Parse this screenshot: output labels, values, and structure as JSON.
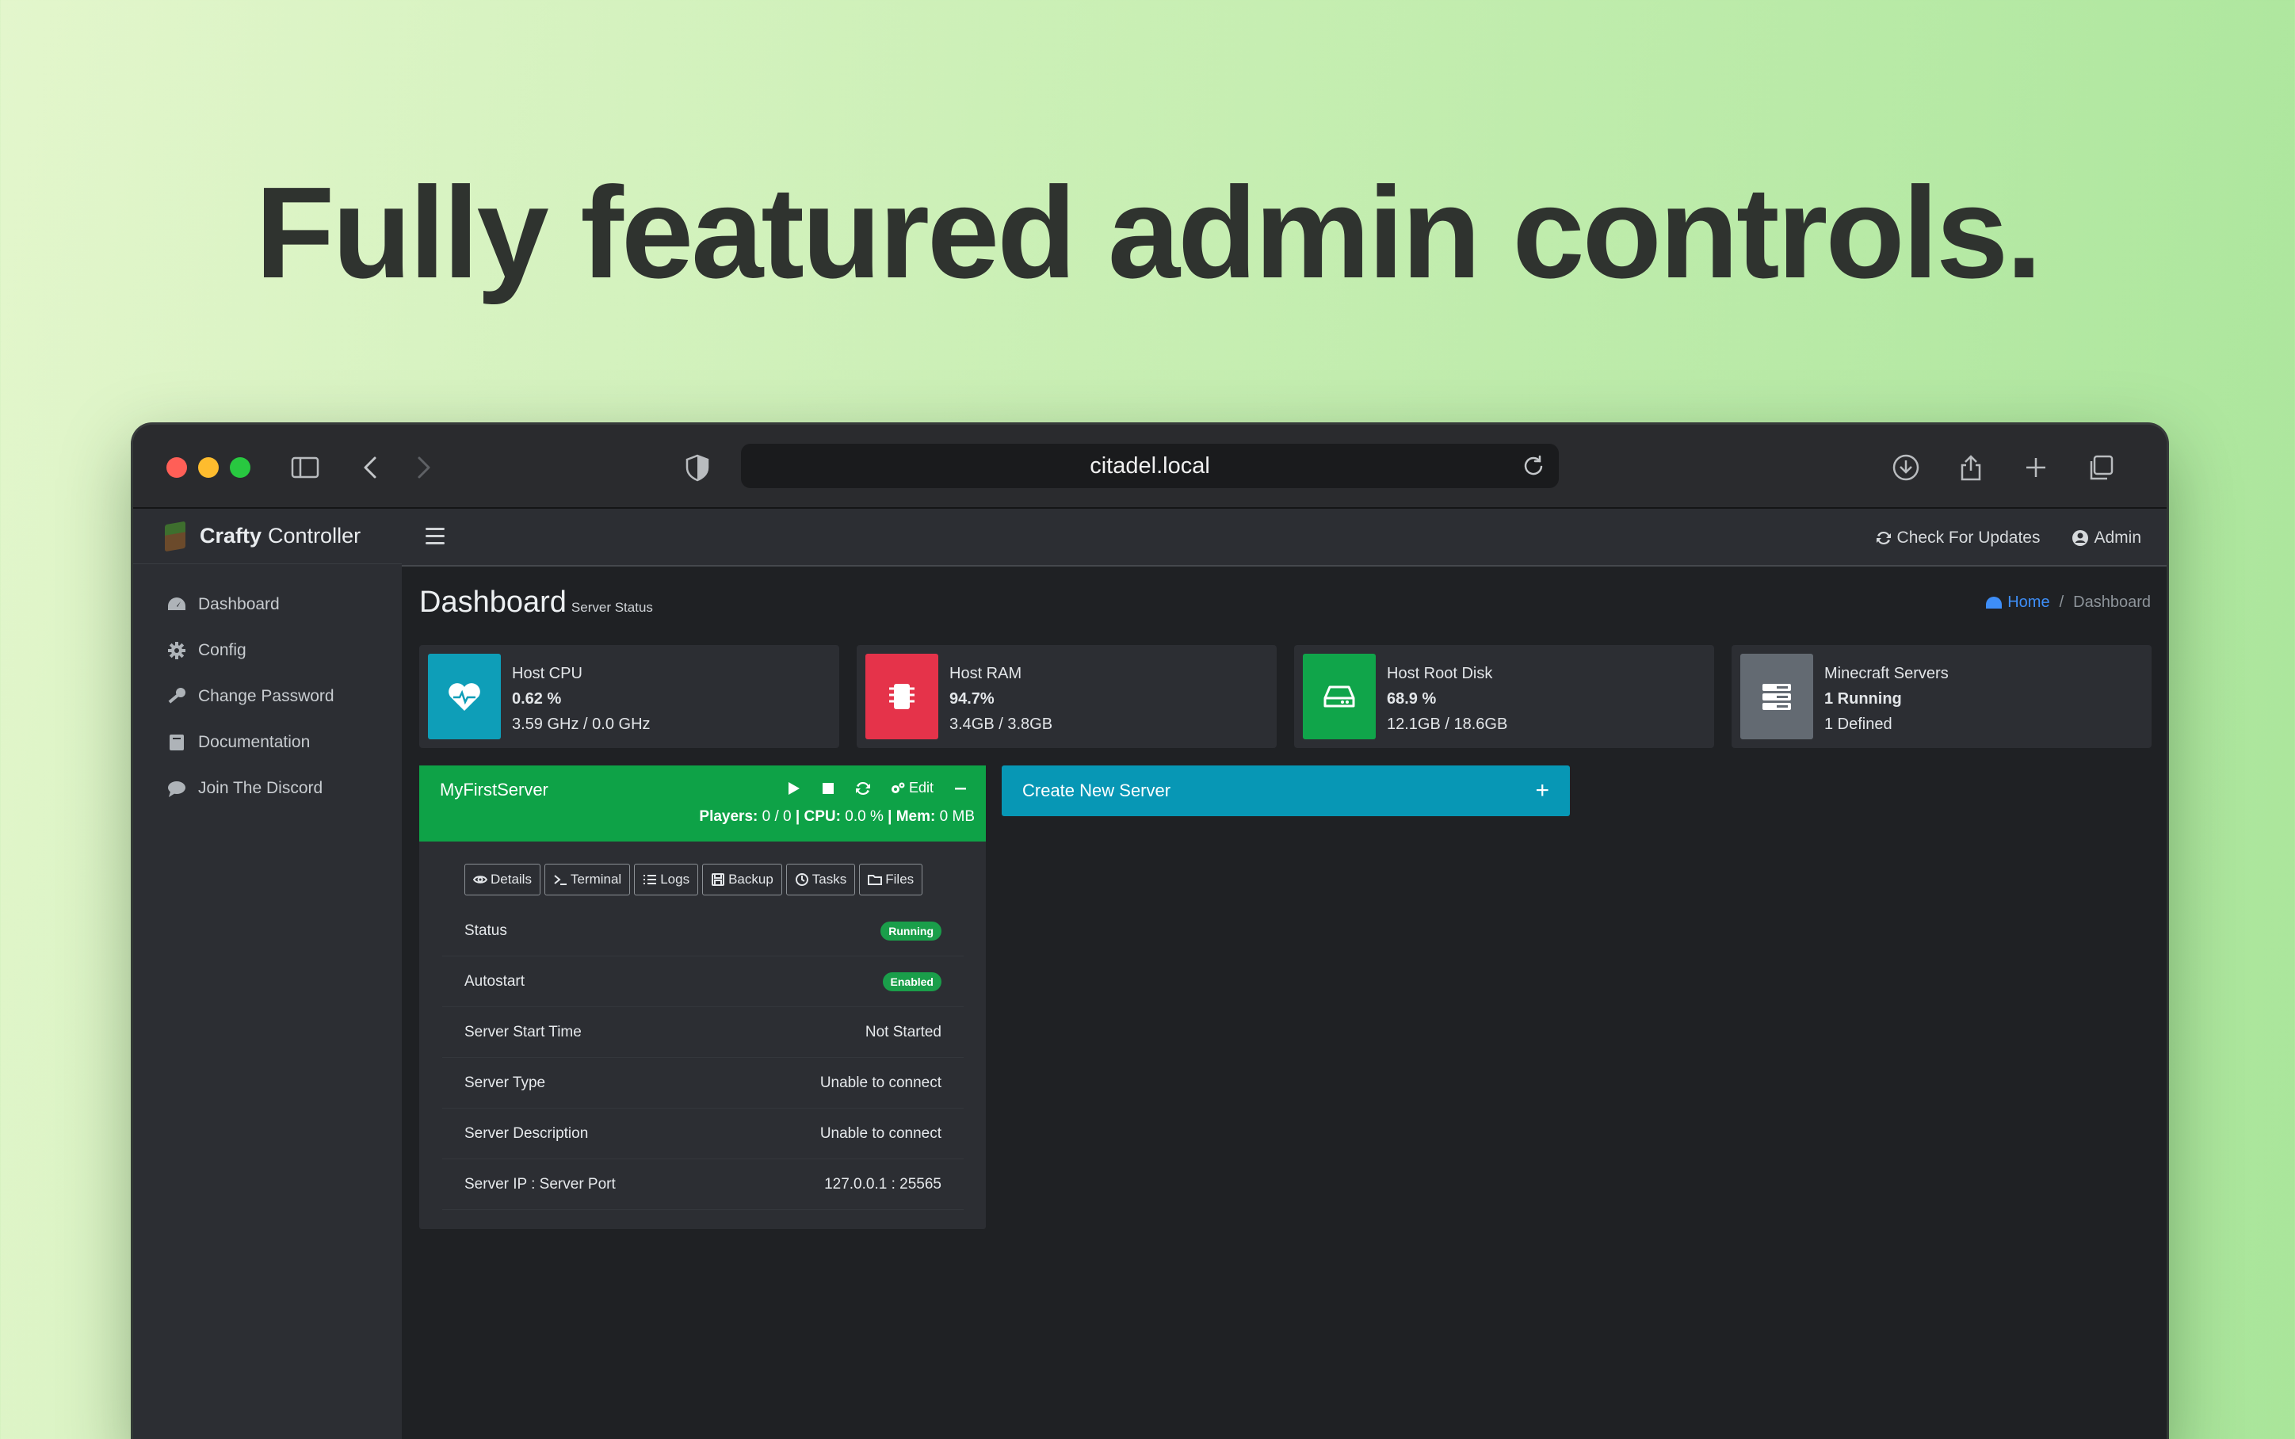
{
  "headline": "Fully featured admin controls.",
  "browser": {
    "url": "citadel.local"
  },
  "app": {
    "brand_bold": "Crafty",
    "brand_rest": "Controller",
    "sidebar": [
      {
        "label": "Dashboard",
        "icon": "tachometer-icon"
      },
      {
        "label": "Config",
        "icon": "gear-icon"
      },
      {
        "label": "Change Password",
        "icon": "key-icon"
      },
      {
        "label": "Documentation",
        "icon": "book-icon"
      },
      {
        "label": "Join The Discord",
        "icon": "chat-icon"
      }
    ],
    "topbar": {
      "check_updates": "Check For Updates",
      "admin": "Admin"
    },
    "page": {
      "title": "Dashboard",
      "subtitle": "Server Status"
    },
    "breadcrumb": {
      "home": "Home",
      "sep": "/",
      "current": "Dashboard"
    },
    "stats": [
      {
        "title": "Host CPU",
        "value": "0.62 %",
        "detail": "3.59 GHz / 0.0 GHz",
        "color": "#0e9eb8",
        "icon": "heartbeat-icon"
      },
      {
        "title": "Host RAM",
        "value": "94.7%",
        "detail": "3.4GB / 3.8GB",
        "color": "#e5334a",
        "icon": "memory-chip-icon"
      },
      {
        "title": "Host Root Disk",
        "value": "68.9 %",
        "detail": "12.1GB / 18.6GB",
        "color": "#10a54a",
        "icon": "hard-drive-icon"
      },
      {
        "title": "Minecraft Servers",
        "value": "1 Running",
        "detail": "1 Defined",
        "color": "#636a72",
        "icon": "server-icon"
      }
    ],
    "server": {
      "name": "MyFirstServer",
      "edit": "Edit",
      "players_label": "Players:",
      "players": "0 / 0",
      "sep": "|",
      "cpu_label": "CPU:",
      "cpu": "0.0 %",
      "mem_label": "Mem:",
      "mem": "0 MB",
      "tabs": [
        "Details",
        "Terminal",
        "Logs",
        "Backup",
        "Tasks",
        "Files"
      ],
      "rows": [
        {
          "label": "Status",
          "value": "Running",
          "badge": true
        },
        {
          "label": "Autostart",
          "value": "Enabled",
          "badge": true
        },
        {
          "label": "Server Start Time",
          "value": "Not Started"
        },
        {
          "label": "Server Type",
          "value": "Unable to connect"
        },
        {
          "label": "Server Description",
          "value": "Unable to connect"
        },
        {
          "label": "Server IP : Server Port",
          "value": "127.0.0.1 : 25565"
        }
      ]
    },
    "create_server": {
      "label": "Create New Server",
      "plus": "+"
    }
  }
}
